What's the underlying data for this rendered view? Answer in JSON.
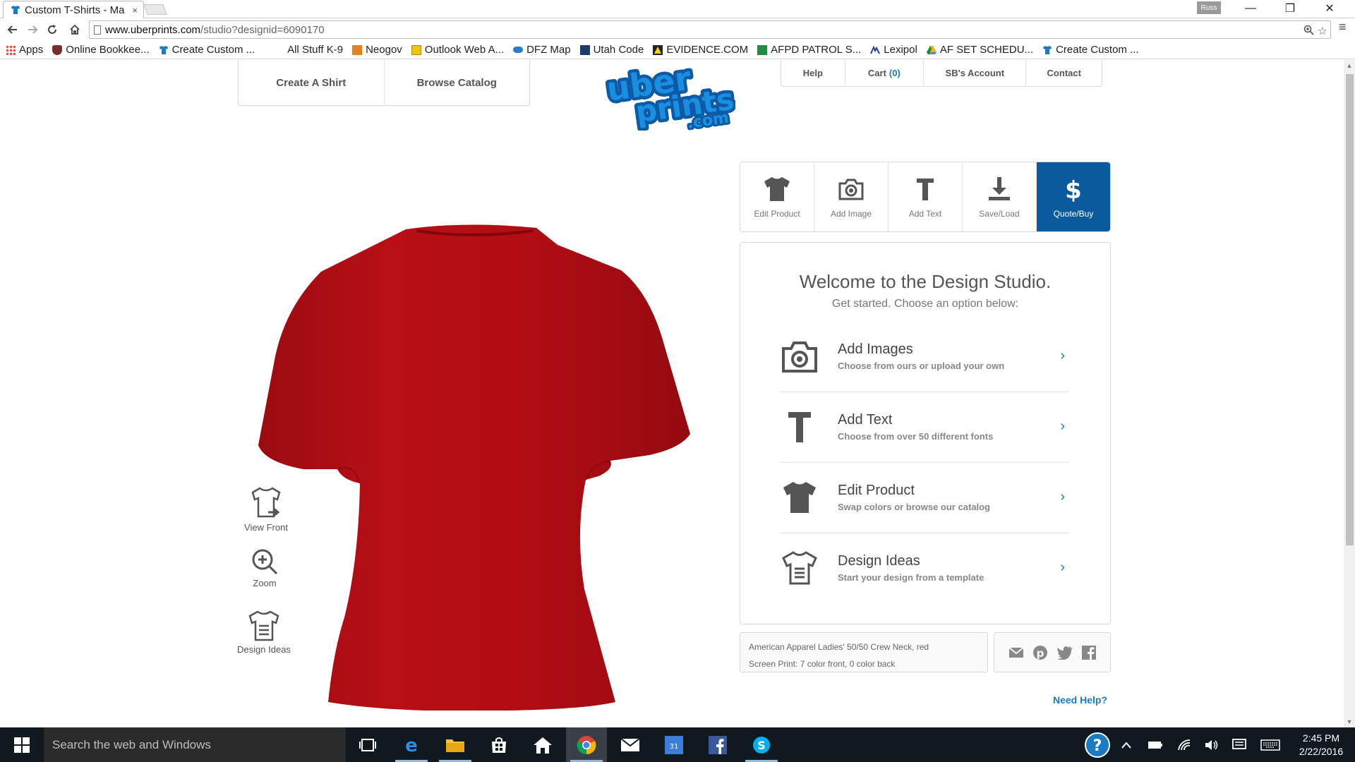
{
  "browser": {
    "tab_title": "Custom T-Shirts - Ma",
    "tab_close": "×",
    "profile": "Russ",
    "url_host": "www.uberprints.com",
    "url_path": "/studio?designid=6090170",
    "window_controls": {
      "minimize": "—",
      "restore": "❐",
      "close": "✕"
    }
  },
  "bookmarks": [
    {
      "label": "Apps",
      "icon_color": "#e74c3c"
    },
    {
      "label": "Online Bookkee...",
      "icon_color": "#7a2d2d"
    },
    {
      "label": "Create Custom ...",
      "icon_color": "#1a7bc4"
    },
    {
      "label": "All Stuff K-9",
      "icon_color": "#ffffff"
    },
    {
      "label": "Neogov",
      "icon_color": "#e67e22"
    },
    {
      "label": "Outlook Web A...",
      "icon_color": "#f1c40f"
    },
    {
      "label": "DFZ Map",
      "icon_color": "#2c7bd0"
    },
    {
      "label": "Utah Code",
      "icon_color": "#1c3c6e"
    },
    {
      "label": "EVIDENCE.COM",
      "icon_color": "#f5d300"
    },
    {
      "label": "AFPD PATROL S...",
      "icon_color": "#1e8e3e"
    },
    {
      "label": "Lexipol",
      "icon_color": "#2c3e8f"
    },
    {
      "label": "AF SET SCHEDU...",
      "icon_color": "#f4b400"
    },
    {
      "label": "Create Custom ...",
      "icon_color": "#1a7bc4"
    }
  ],
  "header": {
    "left_nav": [
      "Create A Shirt",
      "Browse Catalog"
    ],
    "top_nav": {
      "help": "Help",
      "cart_label": "Cart",
      "cart_count": "(0)",
      "account": "SB's Account",
      "contact": "Contact"
    }
  },
  "side_tools": [
    "View Front",
    "Zoom",
    "Design Ideas"
  ],
  "tools": [
    {
      "label": "Edit Product",
      "icon": "tshirt-icon"
    },
    {
      "label": "Add Image",
      "icon": "camera-icon"
    },
    {
      "label": "Add Text",
      "icon": "text-icon"
    },
    {
      "label": "Save/Load",
      "icon": "download-icon"
    },
    {
      "label": "Quote/Buy",
      "icon": "dollar-icon",
      "active": true
    }
  ],
  "welcome": {
    "title": "Welcome to the Design Studio.",
    "subtitle": "Get started.  Choose an option below:",
    "options": [
      {
        "title": "Add Images",
        "desc": "Choose from ours or upload your own",
        "icon": "camera-icon"
      },
      {
        "title": "Add Text",
        "desc": "Choose from over 50 different fonts",
        "icon": "text-icon"
      },
      {
        "title": "Edit Product",
        "desc": "Swap colors or browse our catalog",
        "icon": "tshirt-icon"
      },
      {
        "title": "Design Ideas",
        "desc": "Start your design from a template",
        "icon": "template-shirt-icon"
      }
    ],
    "chevron": "›"
  },
  "product_info": {
    "line1": "American Apparel Ladies' 50/50 Crew Neck, red",
    "line2": "Screen Print:  7 color front, 0 color back"
  },
  "need_help": "Need Help?",
  "colors": {
    "accent": "#0b5a9c",
    "link": "#1a7bc4",
    "shirt": "#b50d14"
  },
  "taskbar": {
    "search_placeholder": "Search the web and Windows",
    "time": "2:45 PM",
    "date": "2/22/2016"
  }
}
